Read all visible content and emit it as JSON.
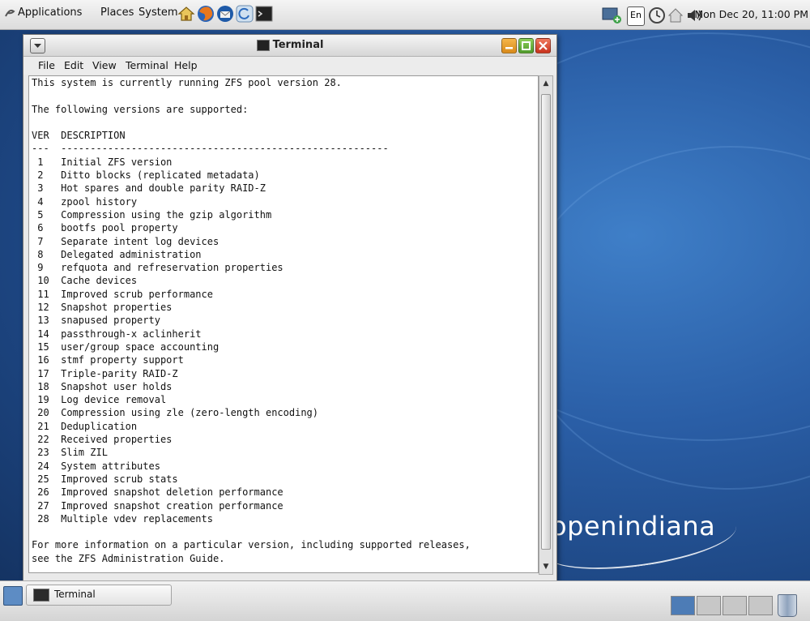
{
  "top_panel": {
    "menus": [
      "Applications",
      "Places",
      "System"
    ],
    "launchers": [
      "home-icon",
      "firefox-icon",
      "thunderbird-icon",
      "update-icon",
      "terminal-icon"
    ],
    "tray": {
      "network_icon": "network-icon",
      "keyboard_layout": "En",
      "icons": [
        "clock-icon",
        "home-lock-icon",
        "volume-icon"
      ]
    },
    "clock": "Mon Dec 20, 11:00 PM"
  },
  "window": {
    "title": "Terminal",
    "menu": [
      {
        "label": "File",
        "accel": "F"
      },
      {
        "label": "Edit",
        "accel": "E"
      },
      {
        "label": "View",
        "accel": "V"
      },
      {
        "label": "Terminal",
        "accel": "T"
      },
      {
        "label": "Help",
        "accel": "H"
      }
    ],
    "terminal_lines": [
      "This system is currently running ZFS pool version 28.",
      "",
      "The following versions are supported:",
      "",
      "VER  DESCRIPTION",
      "---  --------------------------------------------------------",
      " 1   Initial ZFS version",
      " 2   Ditto blocks (replicated metadata)",
      " 3   Hot spares and double parity RAID-Z",
      " 4   zpool history",
      " 5   Compression using the gzip algorithm",
      " 6   bootfs pool property",
      " 7   Separate intent log devices",
      " 8   Delegated administration",
      " 9   refquota and refreservation properties",
      " 10  Cache devices",
      " 11  Improved scrub performance",
      " 12  Snapshot properties",
      " 13  snapused property",
      " 14  passthrough-x aclinherit",
      " 15  user/group space accounting",
      " 16  stmf property support",
      " 17  Triple-parity RAID-Z",
      " 18  Snapshot user holds",
      " 19  Log device removal",
      " 20  Compression using zle (zero-length encoding)",
      " 21  Deduplication",
      " 22  Received properties",
      " 23  Slim ZIL",
      " 24  System attributes",
      " 25  Improved scrub stats",
      " 26  Improved snapshot deletion performance",
      " 27  Improved snapshot creation performance",
      " 28  Multiple vdev replacements",
      "",
      "For more information on a particular version, including supported releases,",
      "see the ZFS Administration Guide."
    ]
  },
  "desktop": {
    "logo_text": "openindiana"
  },
  "bottom_panel": {
    "task_label": "Terminal",
    "workspaces": 4
  },
  "colors": {
    "desktop_blue": "#2a5ea6",
    "close_button": "#d9412c",
    "maximize_button": "#6aa83b",
    "minimize_button": "#e69a2b"
  }
}
